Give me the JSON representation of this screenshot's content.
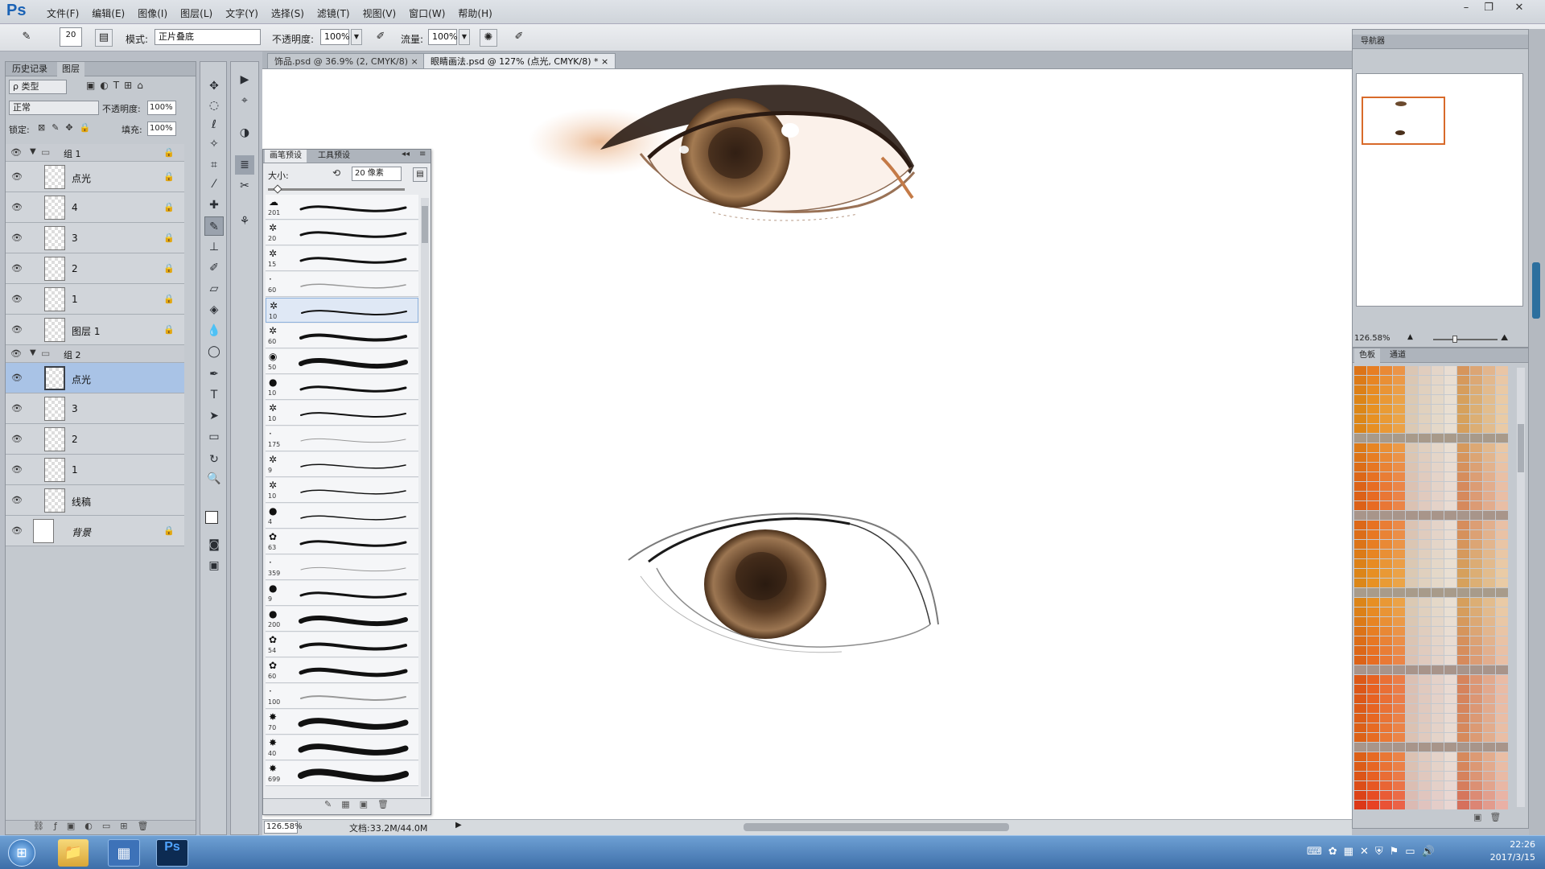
{
  "app": {
    "logo": "Ps",
    "menu": [
      "文件(F)",
      "编辑(E)",
      "图像(I)",
      "图层(L)",
      "文字(Y)",
      "选择(S)",
      "滤镜(T)",
      "视图(V)",
      "窗口(W)",
      "帮助(H)"
    ],
    "window_controls": [
      "–",
      "❐",
      "✕"
    ]
  },
  "options_bar": {
    "brush_size": "20",
    "mode_label": "模式:",
    "mode_value": "正片叠底",
    "opacity_label": "不透明度:",
    "opacity_value": "100%",
    "flow_label": "流量:",
    "flow_value": "100%"
  },
  "left_panel": {
    "tabs": [
      "历史记录",
      "图层"
    ],
    "filter_label": "ρ 类型",
    "blend_mode": "正常",
    "opacity_label": "不透明度:",
    "opacity_value": "100%",
    "lock_label": "锁定:",
    "fill_label": "填充:",
    "fill_value": "100%",
    "groups": [
      {
        "name": "组 1",
        "layers": [
          "点光",
          "4",
          "3",
          "2",
          "1",
          "图层 1"
        ]
      },
      {
        "name": "组 2",
        "layers": [
          "点光",
          "3",
          "2",
          "1",
          "线稿"
        ]
      }
    ],
    "background_layer": "背景",
    "selected_layer": "点光"
  },
  "document_tabs": [
    {
      "label": "饰品.psd @ 36.9% (2, CMYK/8)",
      "close": "×"
    },
    {
      "label": "眼睛画法.psd @ 127% (点光, CMYK/8) *",
      "close": "×"
    }
  ],
  "status_bar": {
    "zoom": "126.58%",
    "doc_info": "文档:33.2M/44.0M"
  },
  "brush_panel": {
    "tabs": [
      "画笔预设",
      "工具预设"
    ],
    "size_label": "大小:",
    "size_value": "20 像素",
    "presets": [
      {
        "size": "201",
        "icon": "cloud"
      },
      {
        "size": "20",
        "icon": "scatter"
      },
      {
        "size": "15",
        "icon": "scatter"
      },
      {
        "size": "60",
        "icon": "soft"
      },
      {
        "size": "10",
        "icon": "scatter"
      },
      {
        "size": "60",
        "icon": "scatter"
      },
      {
        "size": "50",
        "icon": "texture"
      },
      {
        "size": "10",
        "icon": "hard"
      },
      {
        "size": "10",
        "icon": "scatter"
      },
      {
        "size": "175",
        "icon": "soft"
      },
      {
        "size": "9",
        "icon": "scatter"
      },
      {
        "size": "10",
        "icon": "scatter"
      },
      {
        "size": "4",
        "icon": "hard"
      },
      {
        "size": "63",
        "icon": "bristle"
      },
      {
        "size": "359",
        "icon": "soft"
      },
      {
        "size": "9",
        "icon": "hard"
      },
      {
        "size": "200",
        "icon": "hard"
      },
      {
        "size": "54",
        "icon": "bristle"
      },
      {
        "size": "60",
        "icon": "bristle"
      },
      {
        "size": "100",
        "icon": "soft"
      },
      {
        "size": "70",
        "icon": "star"
      },
      {
        "size": "40",
        "icon": "star"
      },
      {
        "size": "699",
        "icon": "star"
      }
    ]
  },
  "navigator": {
    "title": "导航器",
    "zoom": "126.58%"
  },
  "swatches": {
    "tabs": [
      "色板",
      "通道"
    ]
  },
  "taskbar": {
    "time": "22:26",
    "date": "2017/3/15"
  }
}
